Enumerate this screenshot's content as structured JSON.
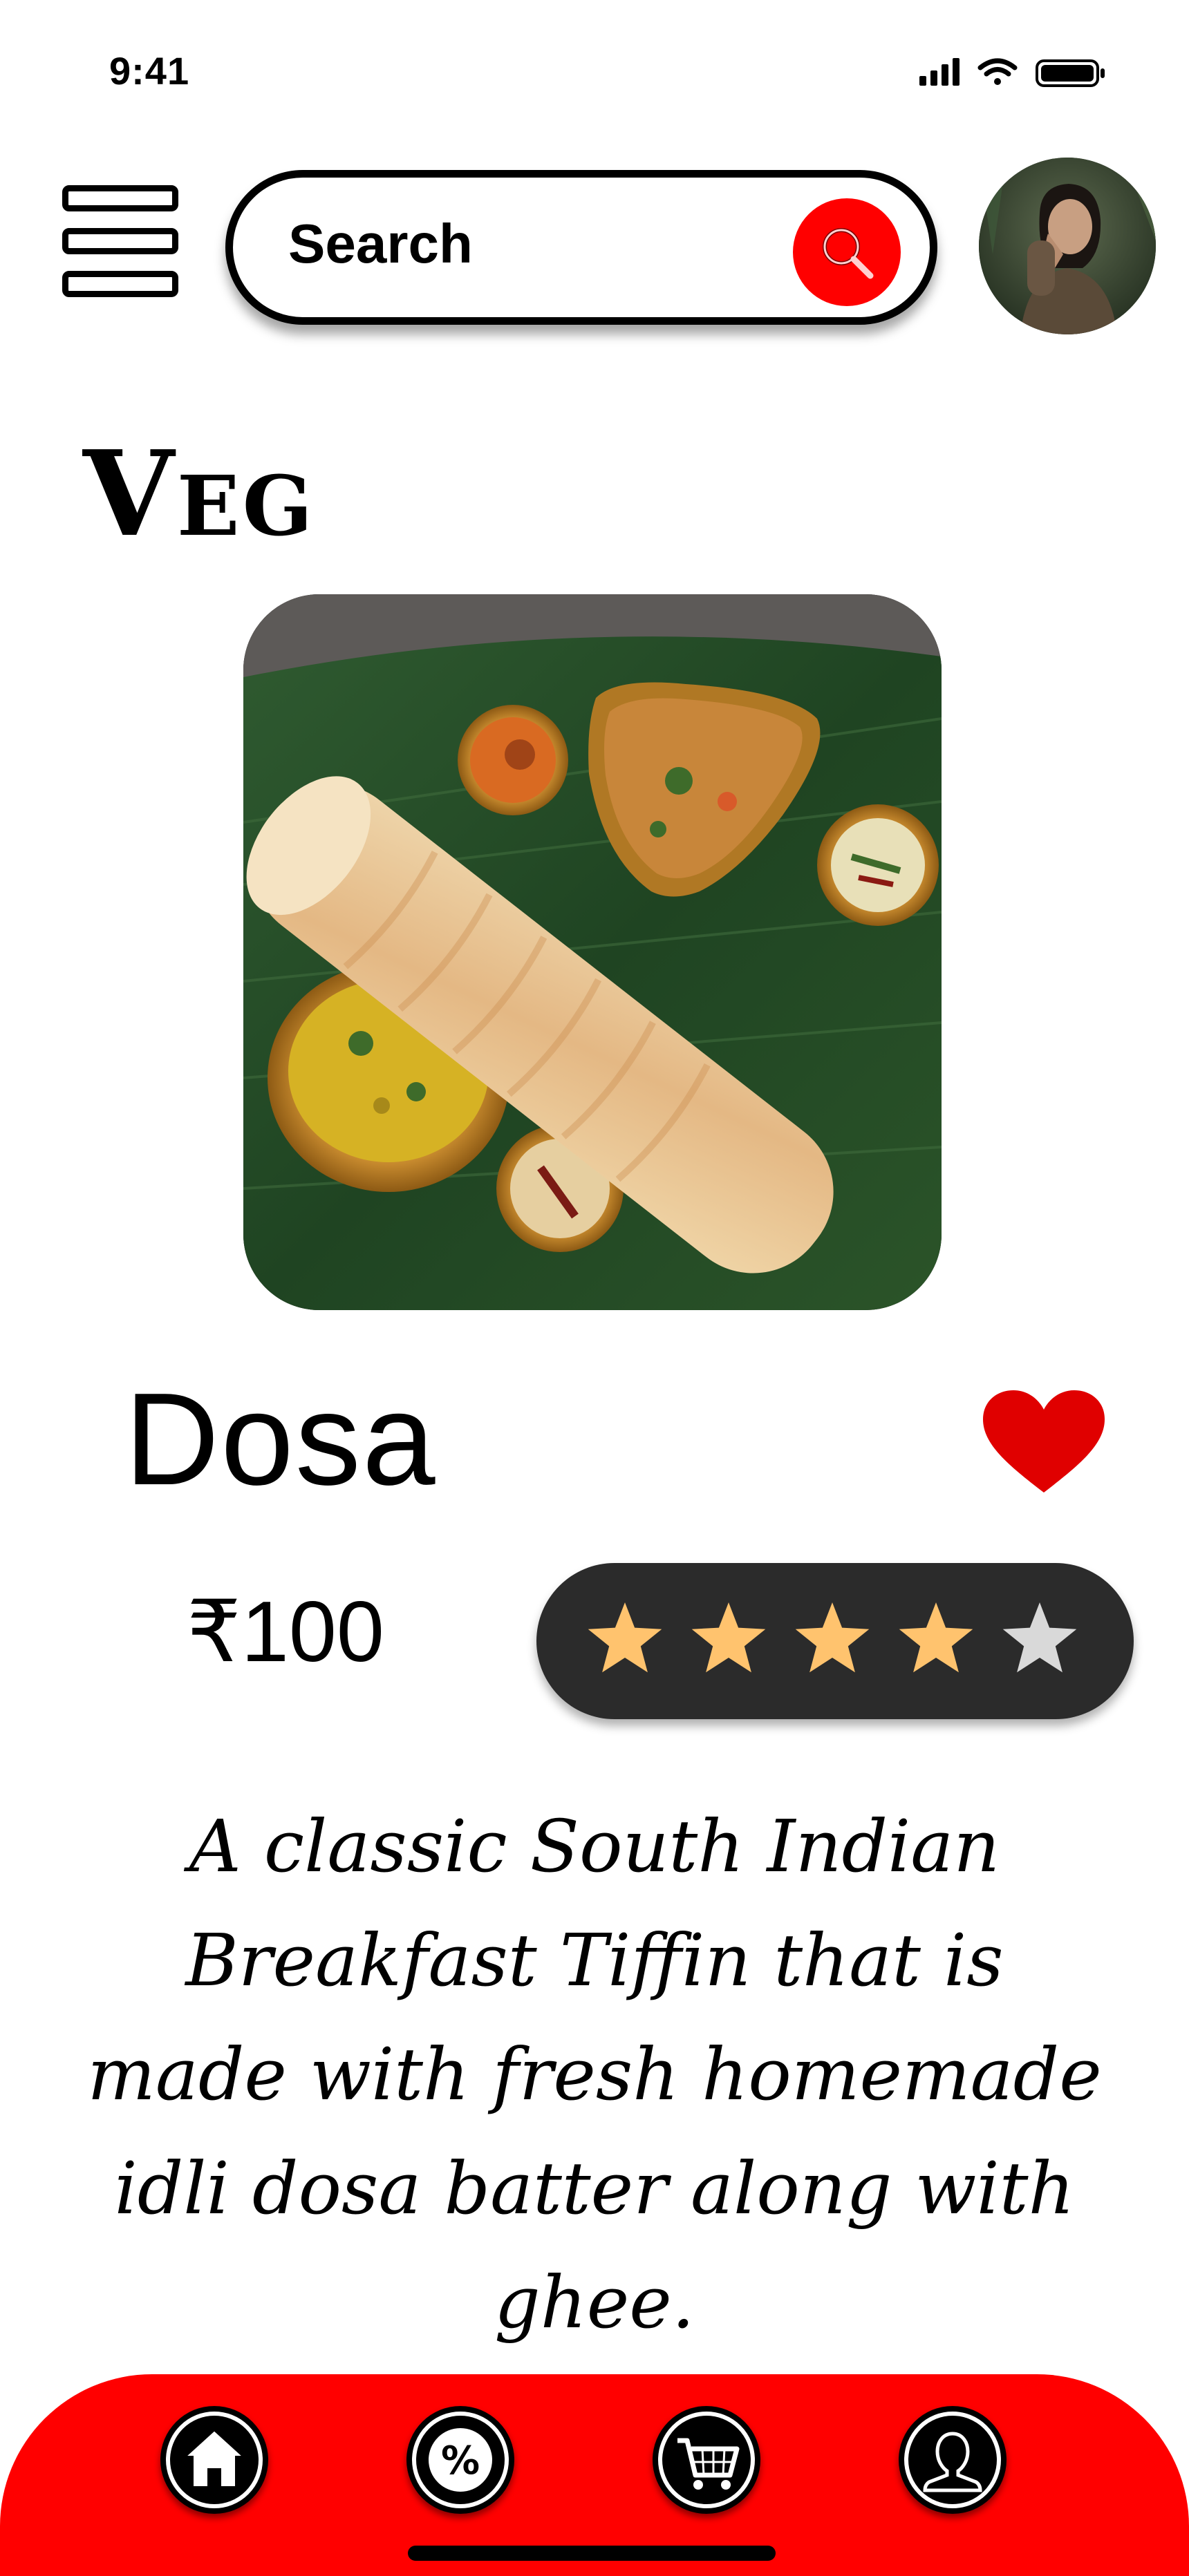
{
  "status_bar": {
    "time": "9:41"
  },
  "header": {
    "search": {
      "label": "Search"
    }
  },
  "category": "Veg",
  "item": {
    "name": "Dosa",
    "price": "₹100",
    "rating": 4,
    "rating_max": 5,
    "favorited": true,
    "description": "A classic South Indian Breakfast Tiffin that is made with fresh homemade idli dosa batter along with ghee."
  },
  "bottom_nav": {
    "items": [
      {
        "icon": "home-icon"
      },
      {
        "icon": "discount-icon"
      },
      {
        "icon": "cart-icon"
      },
      {
        "icon": "profile-icon"
      }
    ]
  },
  "colors": {
    "accent": "#ff0000",
    "star_filled": "#ffc36e",
    "star_empty": "#d9d9d9",
    "pill": "#2b2b2b"
  }
}
